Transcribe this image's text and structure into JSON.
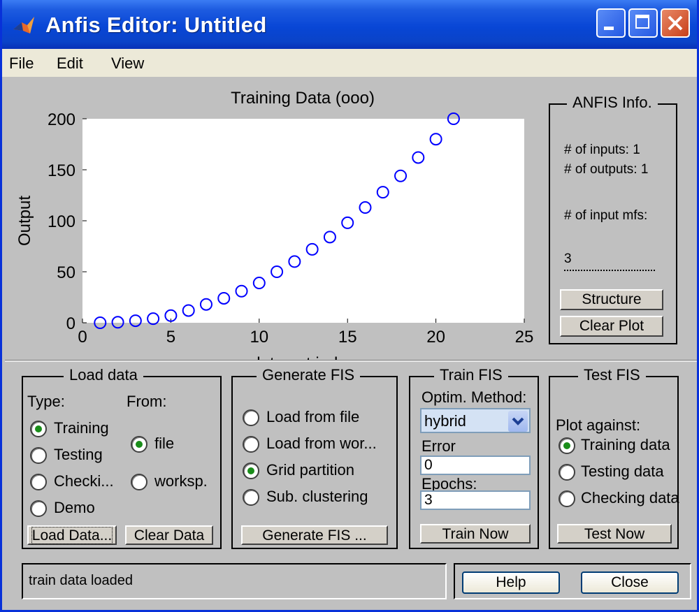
{
  "window": {
    "title": "Anfis Editor: Untitled"
  },
  "menu": [
    "File",
    "Edit",
    "View"
  ],
  "chart_data": {
    "type": "scatter",
    "title": "Training Data (ooo)",
    "xlabel": "data set index",
    "ylabel": "Output",
    "xlim": [
      0,
      25
    ],
    "ylim": [
      0,
      200
    ],
    "xticks": [
      0,
      5,
      10,
      15,
      20,
      25
    ],
    "yticks": [
      0,
      50,
      100,
      150,
      200
    ],
    "marker": "o",
    "color": "#0000ff",
    "x": [
      1,
      2,
      3,
      4,
      5,
      6,
      7,
      8,
      9,
      10,
      11,
      12,
      13,
      14,
      15,
      16,
      17,
      18,
      19,
      20,
      21
    ],
    "y": [
      0,
      0.5,
      2,
      4,
      7,
      12,
      18,
      24,
      31,
      39,
      50,
      60,
      72,
      84,
      98,
      113,
      128,
      144,
      162,
      180,
      200
    ]
  },
  "anfis_info": {
    "label": "ANFIS Info.",
    "inputs": "# of inputs: 1",
    "outputs": "# of outputs: 1",
    "input_mfs": "# of input mfs:",
    "mfs_value": "3",
    "structure_btn": "Structure",
    "clear_plot_btn": "Clear Plot"
  },
  "load_data": {
    "label": "Load data",
    "type_label": "Type:",
    "from_label": "From:",
    "types": [
      "Training",
      "Testing",
      "Checki...",
      "Demo"
    ],
    "selected_type": "Training",
    "sources": [
      "file",
      "worksp."
    ],
    "selected_source": "file",
    "load_btn": "Load Data...",
    "clear_btn": "Clear Data"
  },
  "generate_fis": {
    "label": "Generate FIS",
    "options": [
      "Load from file",
      "Load from wor...",
      "Grid partition",
      "Sub. clustering"
    ],
    "selected": "Grid partition",
    "generate_btn": "Generate FIS ..."
  },
  "train_fis": {
    "label": "Train FIS",
    "method_label": "Optim. Method:",
    "method_value": "hybrid",
    "error_label": "Error",
    "error_value": "0",
    "epochs_label": "Epochs:",
    "epochs_value": "3",
    "train_btn": "Train Now"
  },
  "test_fis": {
    "label": "Test FIS",
    "plot_against_label": "Plot against:",
    "options": [
      "Training data",
      "Testing data",
      "Checking data"
    ],
    "selected": "Training data",
    "test_btn": "Test Now"
  },
  "status": {
    "message": "train data loaded"
  },
  "footer": {
    "help_btn": "Help",
    "close_btn": "Close"
  }
}
